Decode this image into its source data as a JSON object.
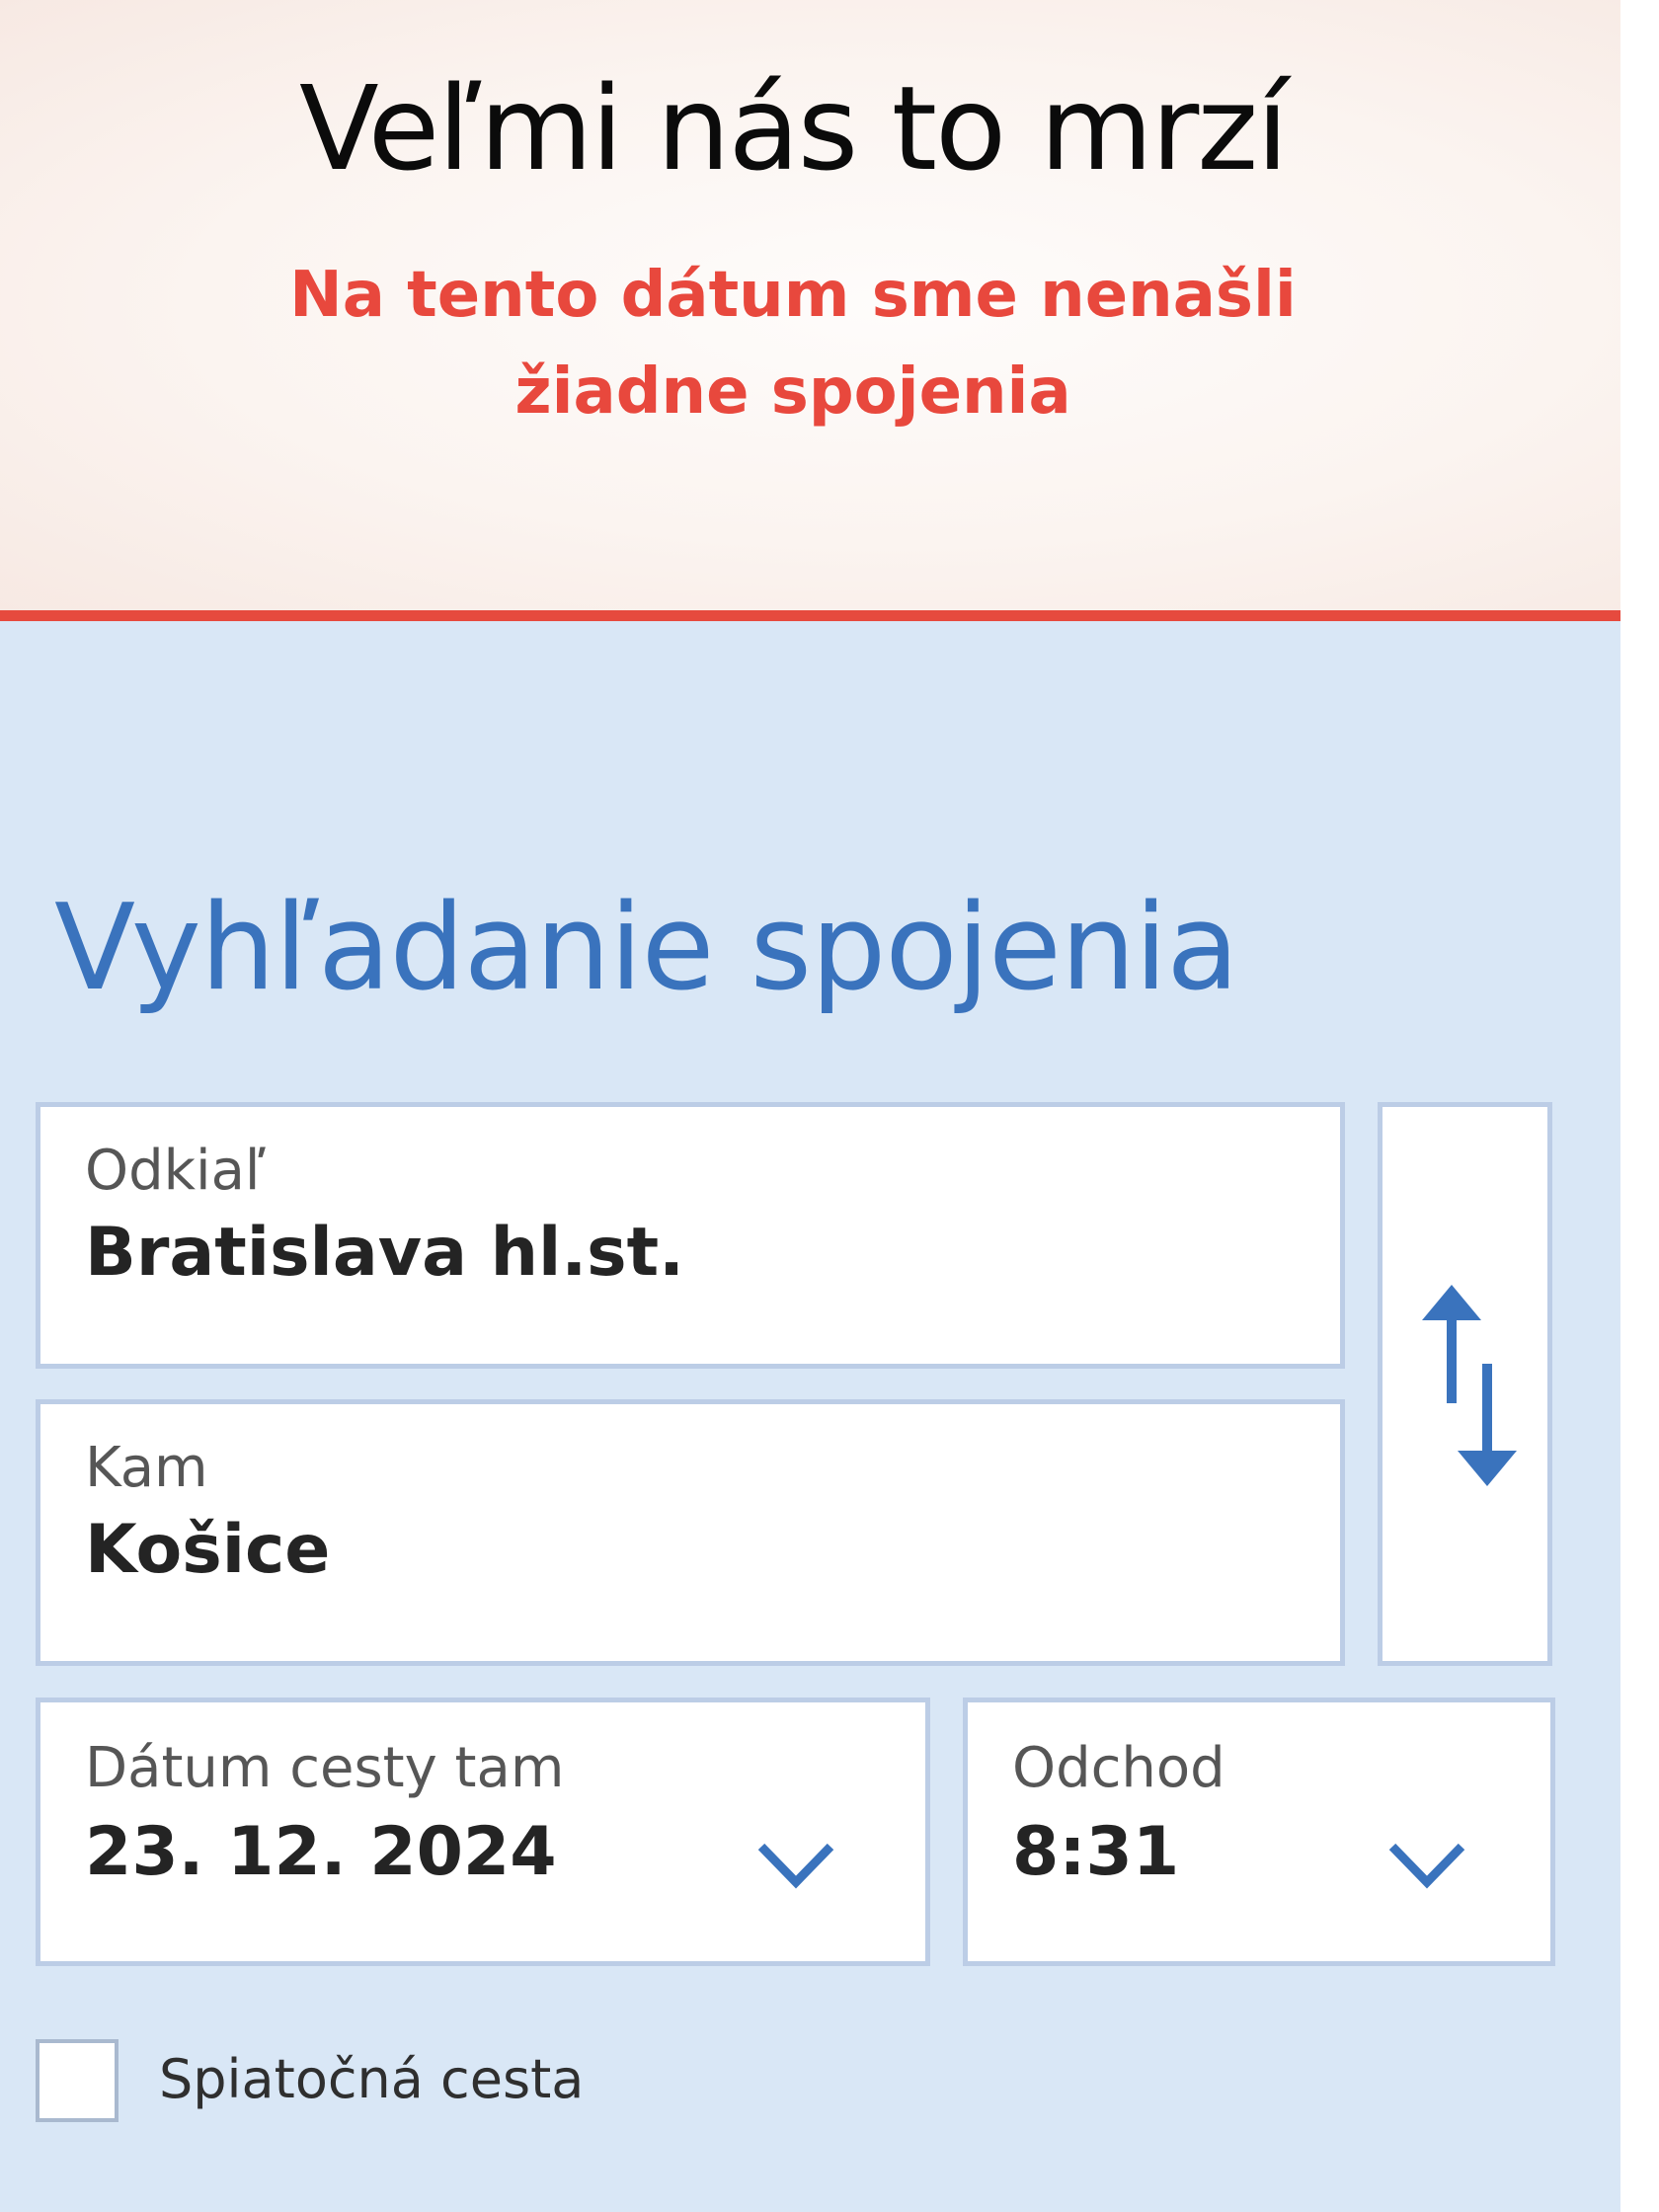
{
  "alert": {
    "title": "Veľmi nás to mrzí",
    "message": "Na tento dátum sme nenašli žiadne spojenia"
  },
  "search": {
    "title": "Vyhľadanie spojenia",
    "from": {
      "label": "Odkiaľ",
      "value": "Bratislava hl.st."
    },
    "to": {
      "label": "Kam",
      "value": "Košice"
    },
    "swap_icon": "swap-vertical-arrows-icon",
    "date": {
      "label": "Dátum cesty tam",
      "value": "23. 12. 2024",
      "icon": "chevron-down-icon"
    },
    "time": {
      "label": "Odchod",
      "value": "8:31",
      "icon": "chevron-down-icon"
    },
    "return_trip": {
      "label": "Spiatočná cesta",
      "checked": false
    }
  },
  "colors": {
    "accent_blue": "#3a73bd",
    "alert_red": "#e8483d",
    "panel_bg": "#d9e7f6",
    "field_border": "#bccde6"
  }
}
